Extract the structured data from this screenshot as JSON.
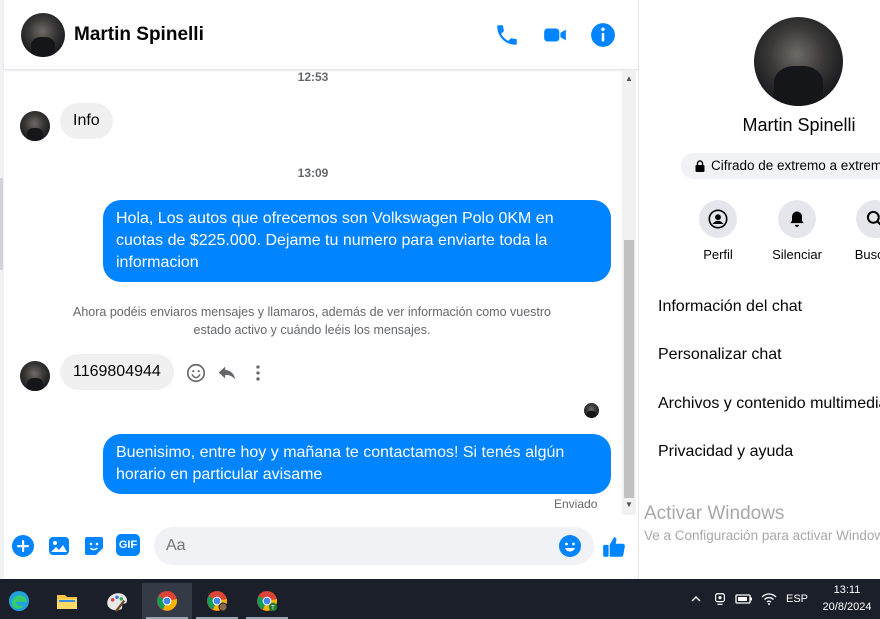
{
  "contact": {
    "name": "Martin Spinelli"
  },
  "chat": {
    "timestamps": [
      "12:53",
      "13:09"
    ],
    "messages": [
      {
        "dir": "in",
        "text": "Info"
      },
      {
        "dir": "out",
        "text": "Hola, Los autos que ofrecemos son Volkswagen Polo 0KM en cuotas de $225.000. Dejame tu numero para enviarte toda la informacion"
      },
      {
        "dir": "in",
        "text": "1169804944"
      },
      {
        "dir": "out",
        "text": "Buenisimo, entre hoy y mañana te contactamos! Si tenés algún horario en particular avisame"
      }
    ],
    "notice": "Ahora podéis enviaros mensajes y llamaros, además de ver información como vuestro estado activo y cuándo leéis los mensajes.",
    "status": "Enviado"
  },
  "composer": {
    "placeholder": "Aa",
    "gif_label": "GIF"
  },
  "info_panel": {
    "name": "Martin Spinelli",
    "encryption": "Cifrado de extremo a extremo",
    "actions": [
      {
        "label": "Perfil",
        "icon": "profile-icon"
      },
      {
        "label": "Silenciar",
        "icon": "bell-icon"
      },
      {
        "label": "Buscar",
        "icon": "search-icon"
      }
    ],
    "menu": [
      "Información del chat",
      "Personalizar chat",
      "Archivos y contenido multimedia",
      "Privacidad y ayuda"
    ]
  },
  "watermark": {
    "line1": "Activar Windows",
    "line2": "Ve a Configuración para activar Windows."
  },
  "taskbar": {
    "language": "ESP",
    "time": "13:11",
    "date": "20/8/2024"
  },
  "colors": {
    "accent": "#0084ff",
    "bubble_in": "#f0f0f0",
    "taskbar": "#1b1f2a"
  }
}
